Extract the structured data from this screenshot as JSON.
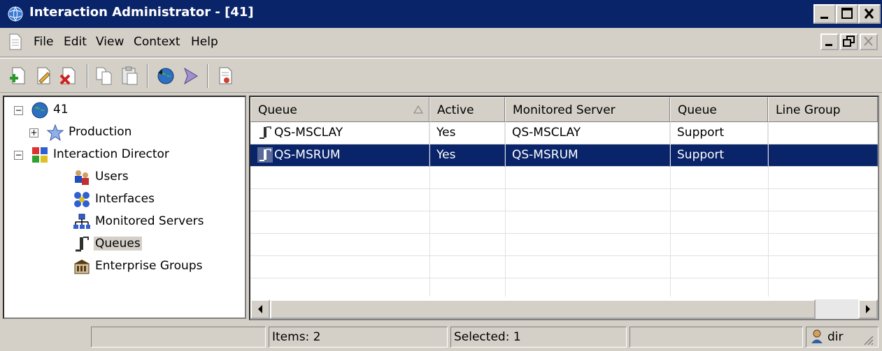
{
  "window": {
    "title": "Interaction Administrator - [41]",
    "title_bar_color": "#0a246a",
    "selection_color": "#0a246a"
  },
  "menu": {
    "items": [
      "File",
      "Edit",
      "View",
      "Context",
      "Help"
    ]
  },
  "toolbar": {
    "buttons": [
      "new-icon",
      "edit-icon",
      "delete-icon",
      "copy-icon",
      "paste-icon",
      "globe-refresh-icon",
      "find-icon",
      "report-icon"
    ]
  },
  "tree": {
    "root": "41",
    "production": "Production",
    "director": "Interaction Director",
    "children": [
      "Users",
      "Interfaces",
      "Monitored Servers",
      "Queues",
      "Enterprise Groups"
    ],
    "selected": "Queues"
  },
  "list": {
    "columns": [
      "Queue",
      "Active",
      "Monitored Server",
      "Queue",
      "Line Group"
    ],
    "rows": [
      {
        "queue": "QS-MSCLAY",
        "active": "Yes",
        "server": "QS-MSCLAY",
        "queue2": "Support",
        "line_group": ""
      },
      {
        "queue": "QS-MSRUM",
        "active": "Yes",
        "server": "QS-MSRUM",
        "queue2": "Support",
        "line_group": ""
      }
    ],
    "selected_row": 1
  },
  "status": {
    "items": "Items: 2",
    "selected": "Selected: 1",
    "user": "dir"
  }
}
